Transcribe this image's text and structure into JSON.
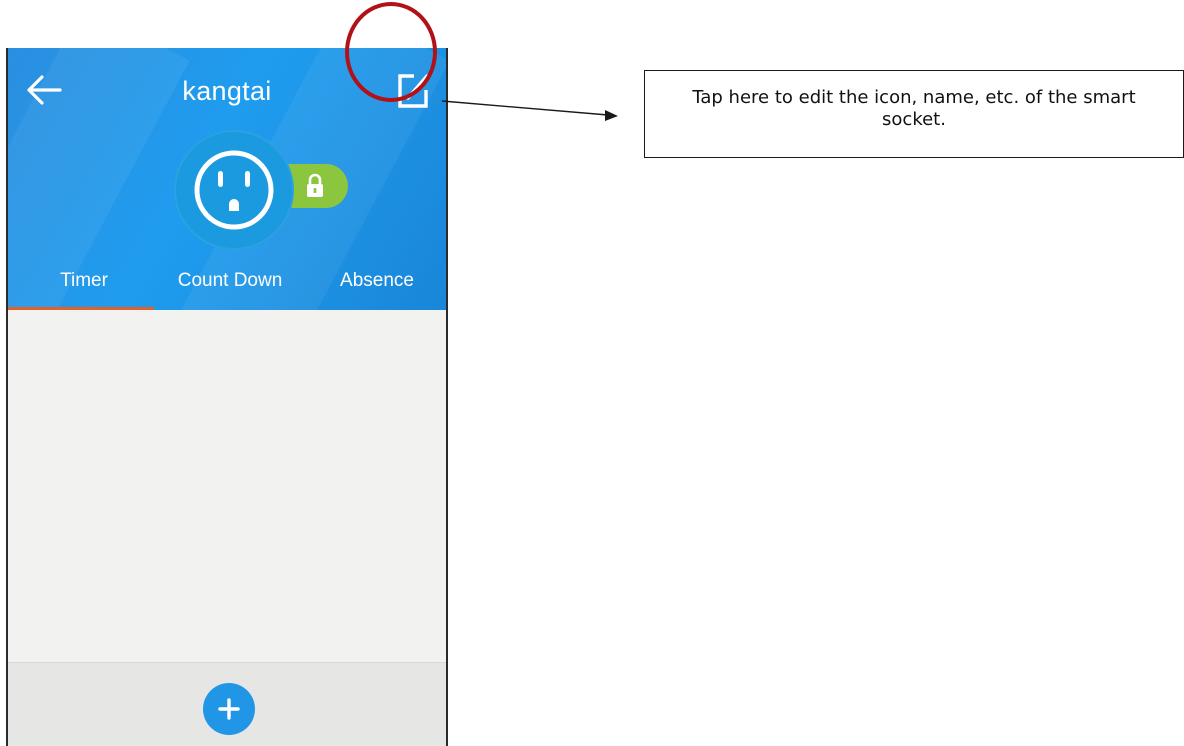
{
  "app": {
    "title": "kangtai"
  },
  "header": {
    "back_icon": "arrow-left-icon",
    "edit_icon": "edit-square-icon",
    "socket_icon": "power-outlet-icon",
    "lock_icon": "padlock-icon"
  },
  "tabs": [
    {
      "label": "Timer",
      "selected": true
    },
    {
      "label": "Count Down",
      "selected": false
    },
    {
      "label": "Absence",
      "selected": false
    }
  ],
  "footer": {
    "add_icon": "plus-icon"
  },
  "annotation": {
    "callout_text": "Tap here to edit the icon, name, etc. of the smart socket."
  },
  "colors": {
    "header_blue": "#1f9cee",
    "lock_green": "#8cc63f",
    "tab_indicator": "#e0622a",
    "highlight_red": "#b01217",
    "add_button_blue": "#2196e6"
  }
}
